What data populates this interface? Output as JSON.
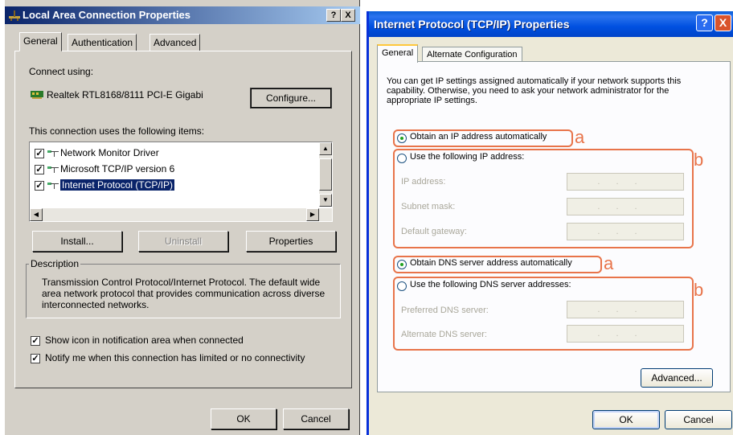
{
  "left_dialog": {
    "title": "Local Area Connection Properties",
    "title_help": "?",
    "title_close": "X",
    "tabs": [
      "General",
      "Authentication",
      "Advanced"
    ],
    "connect_using_label": "Connect using:",
    "adapter_name": "Realtek RTL8168/8111 PCI-E Gigabi",
    "configure_btn": "Configure...",
    "items_label": "This connection uses the following items:",
    "items": [
      {
        "label": "Network Monitor Driver",
        "checked": true
      },
      {
        "label": "Microsoft TCP/IP version 6",
        "checked": true
      },
      {
        "label": "Internet Protocol (TCP/IP)",
        "checked": true
      }
    ],
    "install_btn": "Install...",
    "uninstall_btn": "Uninstall",
    "properties_btn": "Properties",
    "description_label": "Description",
    "description_text": "Transmission Control Protocol/Internet Protocol. The default wide area network protocol that provides communication across diverse interconnected networks.",
    "show_icon_label": "Show icon in notification area when connected",
    "notify_label": "Notify me when this connection has limited or no connectivity",
    "ok_btn": "OK",
    "cancel_btn": "Cancel"
  },
  "right_dialog": {
    "title": "Internet Protocol (TCP/IP) Properties",
    "title_help": "?",
    "title_close": "X",
    "tabs": [
      "General",
      "Alternate Configuration"
    ],
    "intro_text": "You can get IP settings assigned automatically if your network supports this capability. Otherwise, you need to ask your network administrator for the appropriate IP settings.",
    "obtain_ip_auto": "Obtain an IP address automatically",
    "use_following_ip": "Use the following IP address:",
    "ip_address_label": "IP address:",
    "subnet_mask_label": "Subnet mask:",
    "default_gateway_label": "Default gateway:",
    "obtain_dns_auto": "Obtain DNS server address automatically",
    "use_following_dns": "Use the following DNS server addresses:",
    "preferred_dns_label": "Preferred DNS server:",
    "alternate_dns_label": "Alternate DNS server:",
    "ip_placeholder": "...",
    "advanced_btn": "Advanced...",
    "ok_btn": "OK",
    "cancel_btn": "Cancel",
    "annotation_a": "a",
    "annotation_b": "b"
  },
  "colors": {
    "classic_title": "#0a246a",
    "xp_title": "#0054e3",
    "annotation": "#e8744a"
  }
}
